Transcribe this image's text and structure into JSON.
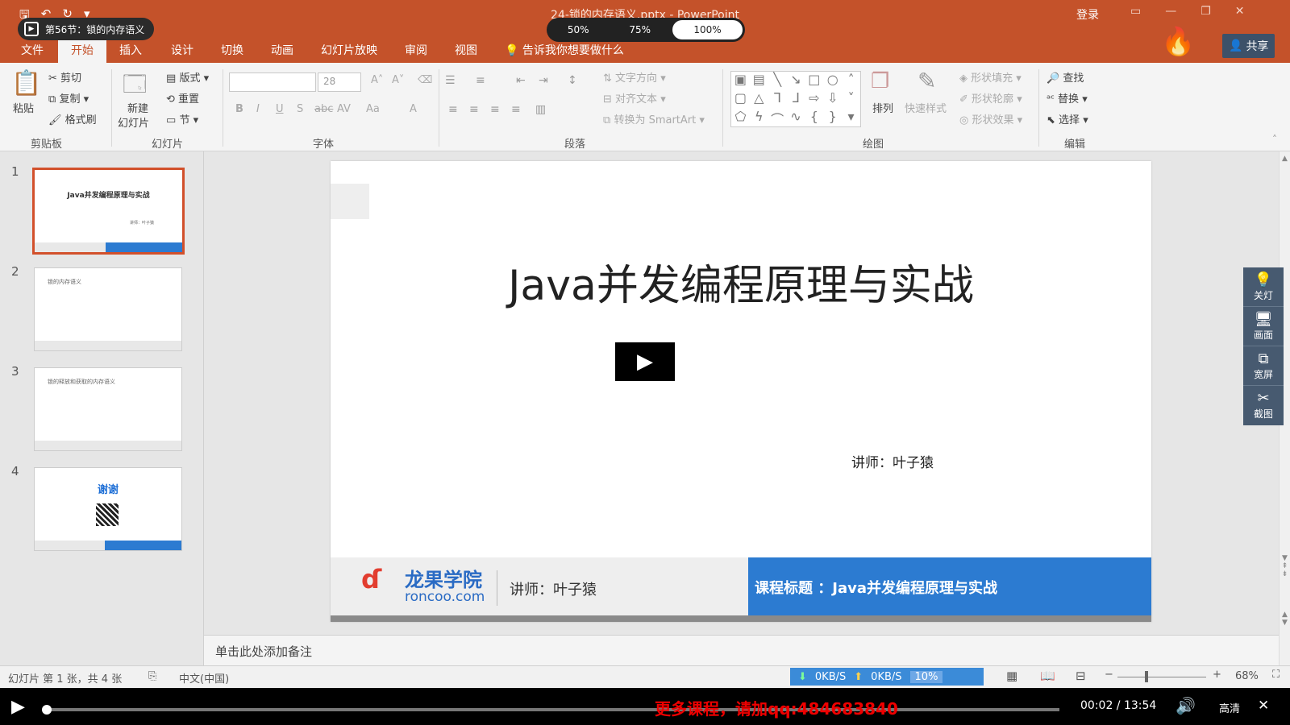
{
  "titlebar": {
    "doc_title": "24-锁的内存语义.pptx - PowerPoint",
    "login": "登录",
    "qat_icons": [
      "save-icon",
      "undo-icon",
      "redo-icon",
      "customize-icon"
    ]
  },
  "player_overlay": {
    "lesson": "第56节：锁的内存语义",
    "speed_options": [
      "50%",
      "75%",
      "100%"
    ],
    "speed_selected": "100%"
  },
  "tabs": [
    "文件",
    "开始",
    "插入",
    "设计",
    "切换",
    "动画",
    "幻灯片放映",
    "审阅",
    "视图"
  ],
  "active_tab": "开始",
  "tellme": "告诉我你想要做什么",
  "share": "共享",
  "ribbon": {
    "clipboard": {
      "paste": "粘贴",
      "cut": "剪切",
      "copy": "复制",
      "format_painter": "格式刷",
      "label": "剪贴板"
    },
    "slides": {
      "new_slide_line1": "新建",
      "new_slide_line2": "幻灯片",
      "layout": "版式",
      "reset": "重置",
      "section": "节",
      "label": "幻灯片"
    },
    "font": {
      "font_name": "",
      "font_size": "28",
      "label": "字体",
      "bold": "B",
      "italic": "I",
      "underline": "U",
      "shadow": "S",
      "strike": "abc",
      "spacing": "AV",
      "case": "Aa",
      "color": "A",
      "grow": "A",
      "shrink": "A"
    },
    "paragraph": {
      "text_direction": "文字方向",
      "align_text": "对齐文本",
      "smartart": "转换为 SmartArt",
      "label": "段落"
    },
    "drawing": {
      "arrange": "排列",
      "quick_styles": "快速样式",
      "shape_fill": "形状填充",
      "shape_outline": "形状轮廓",
      "shape_effects": "形状效果",
      "label": "绘图"
    },
    "editing": {
      "find": "查找",
      "replace": "替换",
      "select": "选择",
      "label": "编辑"
    }
  },
  "thumbnails": [
    {
      "num": "1",
      "title": "Java并发编程原理与实战",
      "sub": "讲师：叶子猿"
    },
    {
      "num": "2",
      "title": "锁的内存语义"
    },
    {
      "num": "3",
      "title": "锁的释放和获取的内存语义"
    },
    {
      "num": "4",
      "title": "谢谢"
    }
  ],
  "slide": {
    "title": "Java并发编程原理与实战",
    "lecturer": "讲师：叶子猿",
    "footer": {
      "brand_cn": "龙果学院",
      "brand_en": "roncoo.com",
      "lecturer": "讲师：叶子猿",
      "course": "课程标题 ：Java并发编程原理与实战"
    }
  },
  "notes_placeholder": "单击此处添加备注",
  "side_tools": [
    {
      "icon": "lamp-icon",
      "glyph": "💡",
      "label": "关灯"
    },
    {
      "icon": "screen-icon",
      "glyph": "🖥",
      "label": "画面"
    },
    {
      "icon": "widescreen-icon",
      "glyph": "⧉",
      "label": "宽屏"
    },
    {
      "icon": "scissors-icon",
      "glyph": "✂",
      "label": "截图"
    }
  ],
  "status": {
    "slide_info": "幻灯片 第 1 张，共 4 张",
    "language": "中文(中国)",
    "download": "0KB/S",
    "upload": "0KB/S",
    "net_percent": "10%",
    "zoom": "68%"
  },
  "player": {
    "time": "00:02 / 13:54",
    "promo": "更多课程，请加qq:484683840",
    "quality": "高清",
    "progress": 0.002
  },
  "colors": {
    "accent": "#c4522a",
    "footer_blue": "#2c7bd1",
    "side_tools": "#475a70",
    "promo": "#e00000"
  }
}
